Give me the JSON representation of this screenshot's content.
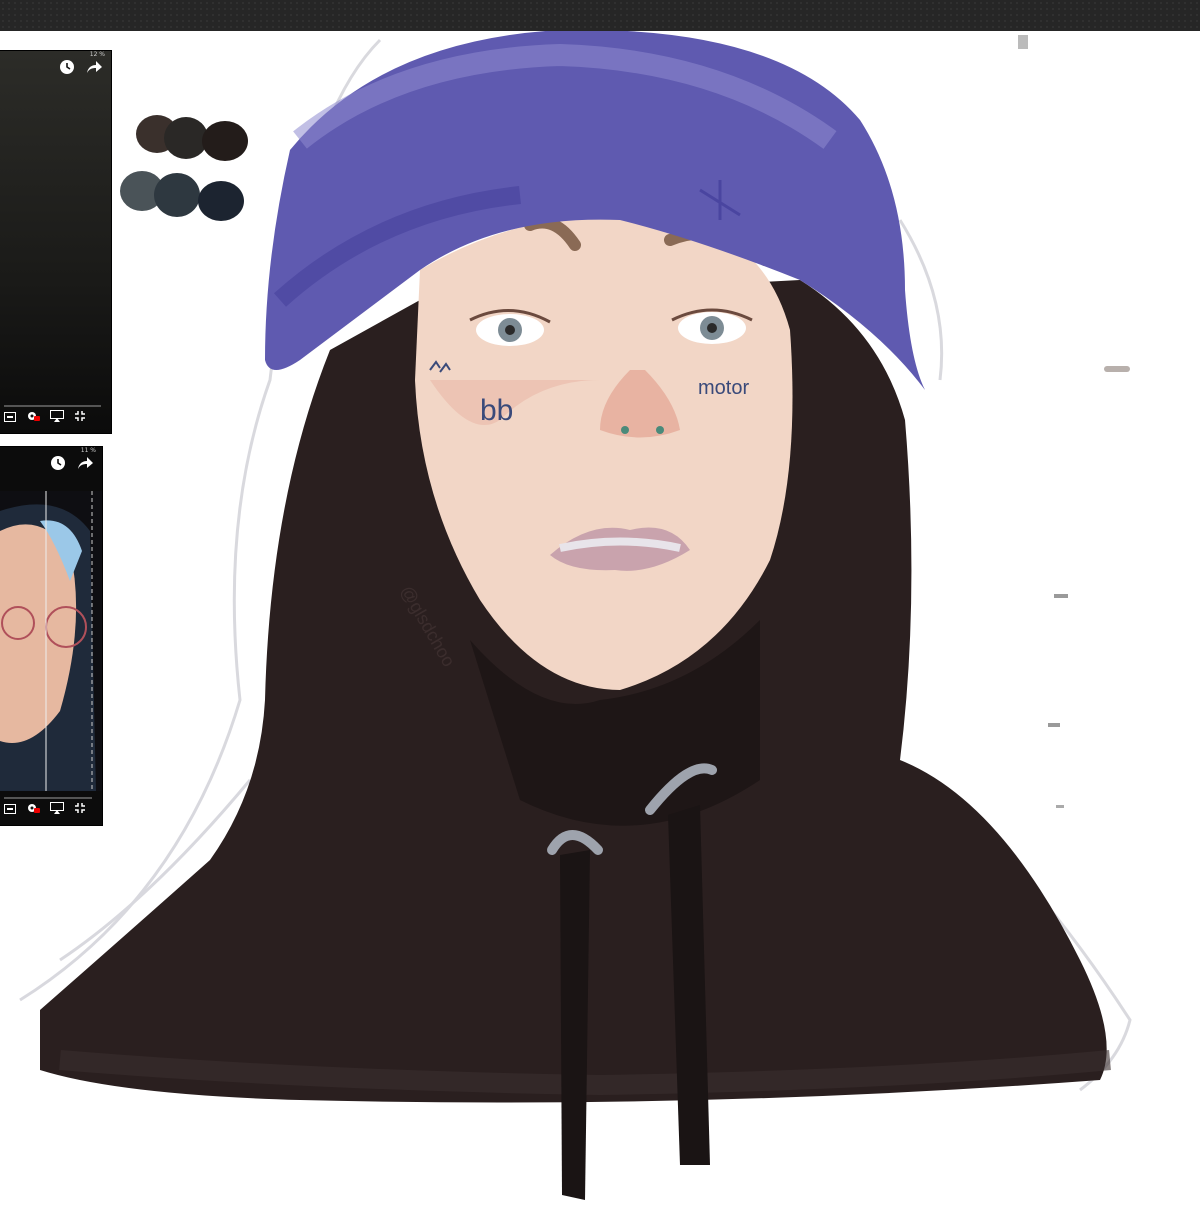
{
  "app": {
    "toolbar_color": "#262626"
  },
  "reference_top": {
    "status": "12 %",
    "icons": [
      "clock-icon",
      "share-icon",
      "captions-icon",
      "settings-icon",
      "airplay-icon",
      "exit-fullscreen-icon"
    ]
  },
  "reference_bottom": {
    "status": "11 %",
    "icons": [
      "clock-icon",
      "share-icon",
      "captions-icon",
      "settings-icon",
      "airplay-icon",
      "exit-fullscreen-icon"
    ]
  },
  "palette": {
    "row1": [
      "#3a302c",
      "#2a2826",
      "#231c1a"
    ],
    "row2": [
      "#4a5358",
      "#2e3840",
      "#1c2430"
    ]
  },
  "painting": {
    "tattoo_text": "motor",
    "tattoo_marks": "bb",
    "colors": {
      "beanie": "#5f5ab0",
      "hoodie": "#2a1f1f",
      "skin": "#f2d6c6"
    }
  }
}
